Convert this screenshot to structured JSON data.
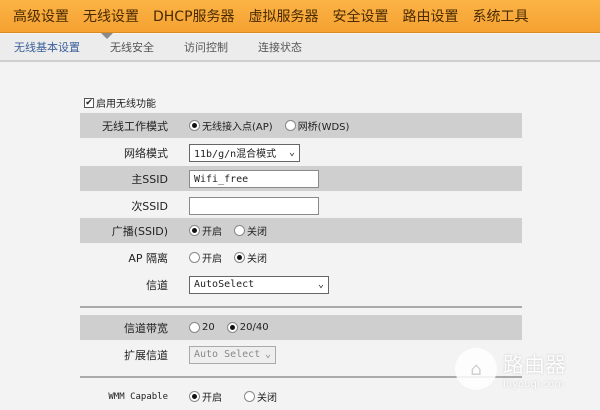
{
  "top_nav": [
    "高级设置",
    "无线设置",
    "DHCP服务器",
    "虚拟服务器",
    "安全设置",
    "路由设置",
    "系统工具"
  ],
  "sub_nav": [
    "无线基本设置",
    "无线安全",
    "访问控制",
    "连接状态"
  ],
  "enable_wireless": {
    "label": "启用无线功能",
    "checked": true
  },
  "work_mode": {
    "label": "无线工作模式",
    "options": [
      "无线接入点(AP)",
      "网桥(WDS)"
    ],
    "selected": 0
  },
  "net_mode": {
    "label": "网络模式",
    "value": "11b/g/n混合模式"
  },
  "ssid1": {
    "label": "主SSID",
    "value": "Wifi_free"
  },
  "ssid2": {
    "label": "次SSID",
    "value": ""
  },
  "broadcast": {
    "label": "广播(SSID)",
    "options": [
      "开启",
      "关闭"
    ],
    "selected": 0
  },
  "ap_isolation": {
    "label": "AP 隔离",
    "options": [
      "开启",
      "关闭"
    ],
    "selected": 1
  },
  "channel": {
    "label": "信道",
    "value": "AutoSelect"
  },
  "bandwidth": {
    "label": "信道带宽",
    "options": [
      "20",
      "20/40"
    ],
    "selected": 1
  },
  "ext_channel": {
    "label": "扩展信道",
    "value": "Auto Select"
  },
  "wmm": {
    "label": "WMM Capable",
    "options": [
      "开启",
      "关闭"
    ],
    "selected": 0
  },
  "watermark": {
    "title": "路由器",
    "site": "luyouqi.com"
  }
}
